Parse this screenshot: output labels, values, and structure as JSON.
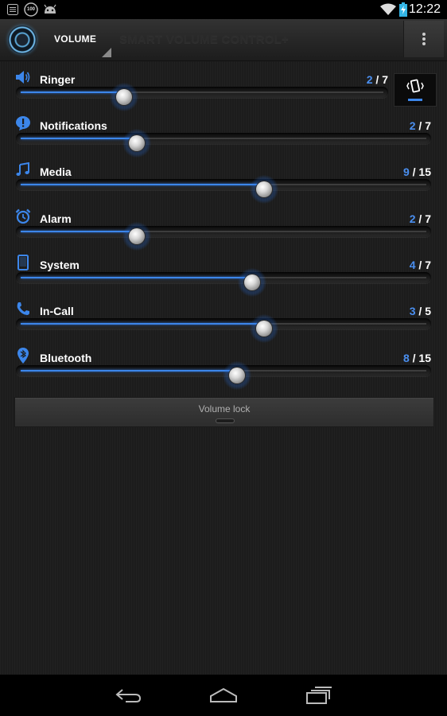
{
  "status_bar": {
    "time": "12:22",
    "notif_icons": [
      "list-icon",
      "percentage-100-icon",
      "android-icon"
    ],
    "badge_text": "100",
    "right_icons": [
      "wifi-icon",
      "battery-charging-icon"
    ]
  },
  "action_bar": {
    "tab_label": "VOLUME",
    "title": "SMART VOLUME CONTROL+",
    "logo_icon": "speaker-logo-icon",
    "overflow_icon": "overflow-menu-icon"
  },
  "streams": [
    {
      "label": "Ringer",
      "current": "2",
      "max": "7",
      "level": 0.2857,
      "icon": "speaker-icon"
    },
    {
      "label": "Notifications",
      "current": "2",
      "max": "7",
      "level": 0.2857,
      "icon": "alert-icon"
    },
    {
      "label": "Media",
      "current": "9",
      "max": "15",
      "level": 0.6,
      "icon": "music-note-icon"
    },
    {
      "label": "Alarm",
      "current": "2",
      "max": "7",
      "level": 0.2857,
      "icon": "alarm-clock-icon"
    },
    {
      "label": "System",
      "current": "4",
      "max": "7",
      "level": 0.5714,
      "icon": "phone-device-icon"
    },
    {
      "label": "In-Call",
      "current": "3",
      "max": "5",
      "level": 0.6,
      "icon": "phone-handset-icon"
    },
    {
      "label": "Bluetooth",
      "current": "8",
      "max": "15",
      "level": 0.5333,
      "icon": "bluetooth-pin-icon"
    }
  ],
  "separator": "/",
  "vibrate": {
    "icon": "vibrate-icon",
    "active": true
  },
  "volume_lock": {
    "label": "Volume lock"
  },
  "colors": {
    "accent": "#3c86ea",
    "value_current": "#4a8ff0"
  },
  "nav": [
    "back-icon",
    "home-icon",
    "recents-icon"
  ]
}
